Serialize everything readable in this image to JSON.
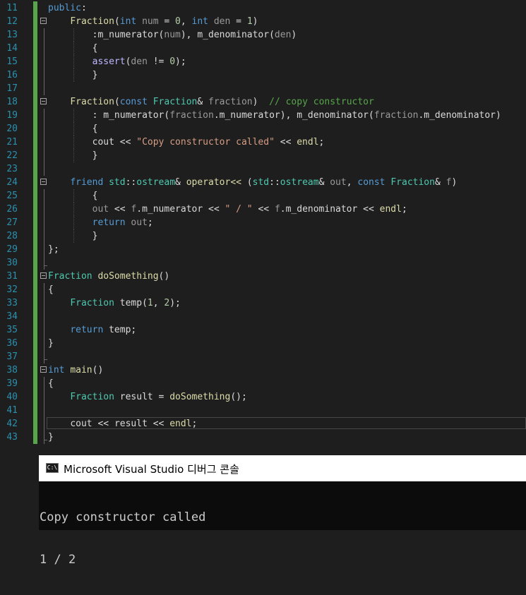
{
  "editor": {
    "lines": [
      {
        "n": "11",
        "html": "<span class=\"kw\">public</span>:",
        "fold": false,
        "chg": true
      },
      {
        "n": "12",
        "html": "    <span class=\"fn\">Fraction</span>(<span class=\"kw\">int</span> <span class=\"pa\">num</span> = <span class=\"nu\">0</span>, <span class=\"kw\">int</span> <span class=\"pa\">den</span> = <span class=\"nu\">1</span>)",
        "fold": true,
        "chg": true
      },
      {
        "n": "13",
        "html": "        :<span class=\"va\">m_numerator</span>(<span class=\"pa\">num</span>), <span class=\"va\">m_denominator</span>(<span class=\"pa\">den</span>)",
        "fold": false,
        "chg": true
      },
      {
        "n": "14",
        "html": "        {",
        "fold": false,
        "chg": true
      },
      {
        "n": "15",
        "html": "        <span class=\"mac\">assert</span>(<span class=\"pa\">den</span> != <span class=\"nu\">0</span>);",
        "fold": false,
        "chg": true
      },
      {
        "n": "16",
        "html": "        }",
        "fold": false,
        "chg": true
      },
      {
        "n": "17",
        "html": "",
        "fold": false,
        "chg": true
      },
      {
        "n": "18",
        "html": "    <span class=\"fn\">Fraction</span>(<span class=\"kw\">const</span> <span class=\"ty\">Fraction</span>&amp; <span class=\"pa\">fraction</span>)  <span class=\"cm\">// copy constructor</span>",
        "fold": true,
        "chg": true
      },
      {
        "n": "19",
        "html": "        : <span class=\"va\">m_numerator</span>(<span class=\"pa\">fraction</span>.<span class=\"va\">m_numerator</span>), <span class=\"va\">m_denominator</span>(<span class=\"pa\">fraction</span>.<span class=\"va\">m_denominator</span>)",
        "fold": false,
        "chg": true
      },
      {
        "n": "20",
        "html": "        {",
        "fold": false,
        "chg": true
      },
      {
        "n": "21",
        "html": "        <span class=\"va\">cout</span> &lt;&lt; <span class=\"st\">\"Copy constructor called\"</span> &lt;&lt; <span class=\"fn\">endl</span>;",
        "fold": false,
        "chg": true
      },
      {
        "n": "22",
        "html": "        }",
        "fold": false,
        "chg": true
      },
      {
        "n": "23",
        "html": "",
        "fold": false,
        "chg": true
      },
      {
        "n": "24",
        "html": "    <span class=\"kw\">friend</span> <span class=\"ty\">std</span>::<span class=\"ty\">ostream</span>&amp; <span class=\"fn\">operator&lt;&lt;</span> (<span class=\"ty\">std</span>::<span class=\"ty\">ostream</span>&amp; <span class=\"pa\">out</span>, <span class=\"kw\">const</span> <span class=\"ty\">Fraction</span>&amp; <span class=\"pa\">f</span>)",
        "fold": true,
        "chg": true
      },
      {
        "n": "25",
        "html": "        {",
        "fold": false,
        "chg": true
      },
      {
        "n": "26",
        "html": "        <span class=\"pa\">out</span> &lt;&lt; <span class=\"pa\">f</span>.<span class=\"va\">m_numerator</span> &lt;&lt; <span class=\"st\">\" / \"</span> &lt;&lt; <span class=\"pa\">f</span>.<span class=\"va\">m_denominator</span> &lt;&lt; <span class=\"fn\">endl</span>;",
        "fold": false,
        "chg": true
      },
      {
        "n": "27",
        "html": "        <span class=\"kw\">return</span> <span class=\"pa\">out</span>;",
        "fold": false,
        "chg": true
      },
      {
        "n": "28",
        "html": "        }",
        "fold": false,
        "chg": true
      },
      {
        "n": "29",
        "html": "};",
        "fold": false,
        "chg": true
      },
      {
        "n": "30",
        "html": "",
        "fold": false,
        "chg": true
      },
      {
        "n": "31",
        "html": "<span class=\"ty\">Fraction</span> <span class=\"fn\">doSomething</span>()",
        "fold": true,
        "chg": true
      },
      {
        "n": "32",
        "html": "{",
        "fold": false,
        "chg": true
      },
      {
        "n": "33",
        "html": "    <span class=\"ty\">Fraction</span> <span class=\"va\">temp</span>(<span class=\"nu\">1</span>, <span class=\"nu\">2</span>);",
        "fold": false,
        "chg": true
      },
      {
        "n": "34",
        "html": "",
        "fold": false,
        "chg": true
      },
      {
        "n": "35",
        "html": "    <span class=\"kw\">return</span> <span class=\"va\">temp</span>;",
        "fold": false,
        "chg": true
      },
      {
        "n": "36",
        "html": "}",
        "fold": false,
        "chg": true
      },
      {
        "n": "37",
        "html": "",
        "fold": false,
        "chg": true
      },
      {
        "n": "38",
        "html": "<span class=\"kw\">int</span> <span class=\"fn\">main</span>()",
        "fold": true,
        "chg": true
      },
      {
        "n": "39",
        "html": "{",
        "fold": false,
        "chg": true
      },
      {
        "n": "40",
        "html": "    <span class=\"ty\">Fraction</span> <span class=\"va\">result</span> = <span class=\"fn\">doSomething</span>();",
        "fold": false,
        "chg": true
      },
      {
        "n": "41",
        "html": "",
        "fold": false,
        "chg": true
      },
      {
        "n": "42",
        "html": "    <span class=\"va\">cout</span> &lt;&lt; <span class=\"va\">result</span> &lt;&lt; <span class=\"fn\">endl</span>;",
        "fold": false,
        "chg": true,
        "current": true
      },
      {
        "n": "43",
        "html": "}",
        "fold": false,
        "chg": true
      }
    ]
  },
  "console": {
    "icon_text": "C:\\",
    "title": "Microsoft Visual Studio 디버그 콘솔",
    "output": [
      "Copy constructor called",
      "1 / 2"
    ]
  }
}
